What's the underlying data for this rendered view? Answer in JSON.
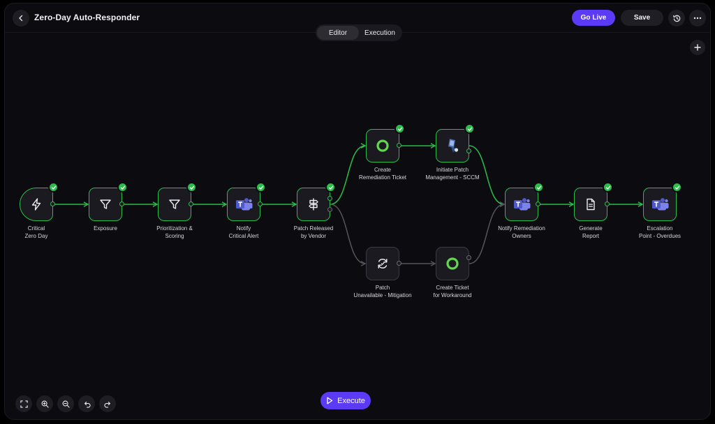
{
  "app": {
    "title": "Zero-Day Auto-Responder",
    "go_live_label": "Go Live",
    "save_label": "Save",
    "tabs": [
      {
        "label": "Editor",
        "active": true
      },
      {
        "label": "Execution",
        "active": false
      }
    ],
    "execute_label": "Execute"
  },
  "colors": {
    "accent": "#5b3bf5",
    "success": "#2bbd4a",
    "canvas": "#0c0b10",
    "node": "#1b1a20",
    "teams": "#5059c9",
    "servicenow": "#62d84e"
  },
  "workflow": {
    "nodes": [
      {
        "id": "critical-zero-day",
        "label": "Critical\nZero Day",
        "icon": "bolt-icon",
        "status": "success"
      },
      {
        "id": "exposure",
        "label": "Exposure",
        "icon": "filter-icon",
        "status": "success"
      },
      {
        "id": "prioritization",
        "label": "Prioritization &\nScoring",
        "icon": "filter-icon",
        "status": "success"
      },
      {
        "id": "notify-critical",
        "label": "Notify\nCritical Alert",
        "icon": "teams-icon",
        "status": "success"
      },
      {
        "id": "patch-released",
        "label": "Patch Released\nby Vendor",
        "icon": "signpost-icon",
        "status": "success"
      },
      {
        "id": "create-ticket",
        "label": "Create\nRemediation Ticket",
        "icon": "servicenow-icon",
        "status": "success"
      },
      {
        "id": "initiate-patch",
        "label": "Initiate Patch\nManagement - SCCM",
        "icon": "sccm-icon",
        "status": "success"
      },
      {
        "id": "patch-unavailable",
        "label": "Patch\nUnavailable - Mitigation",
        "icon": "refresh-icon",
        "status": "idle"
      },
      {
        "id": "workaround-ticket",
        "label": "Create Ticket\nfor Workaround",
        "icon": "servicenow-icon",
        "status": "idle"
      },
      {
        "id": "notify-owners",
        "label": "Notify Remediation\nOwners",
        "icon": "teams-icon",
        "status": "success"
      },
      {
        "id": "generate-report",
        "label": "Generate\nReport",
        "icon": "document-icon",
        "status": "success"
      },
      {
        "id": "escalation",
        "label": "Escalation\nPoint - Overdues",
        "icon": "teams-icon",
        "status": "success"
      }
    ],
    "edges": [
      {
        "from": "critical-zero-day",
        "to": "exposure",
        "active": true
      },
      {
        "from": "exposure",
        "to": "prioritization",
        "active": true
      },
      {
        "from": "prioritization",
        "to": "notify-critical",
        "active": true
      },
      {
        "from": "notify-critical",
        "to": "patch-released",
        "active": true
      },
      {
        "from": "patch-released",
        "to": "create-ticket",
        "active": true
      },
      {
        "from": "create-ticket",
        "to": "initiate-patch",
        "active": true
      },
      {
        "from": "initiate-patch",
        "to": "notify-owners",
        "active": true
      },
      {
        "from": "patch-released",
        "to": "patch-unavailable",
        "active": false
      },
      {
        "from": "patch-unavailable",
        "to": "workaround-ticket",
        "active": false
      },
      {
        "from": "workaround-ticket",
        "to": "notify-owners",
        "active": false
      },
      {
        "from": "notify-owners",
        "to": "generate-report",
        "active": true
      },
      {
        "from": "generate-report",
        "to": "escalation",
        "active": true
      }
    ]
  },
  "canvas_controls": [
    "fit-view-icon",
    "zoom-in-icon",
    "zoom-out-icon",
    "undo-icon",
    "redo-icon"
  ]
}
